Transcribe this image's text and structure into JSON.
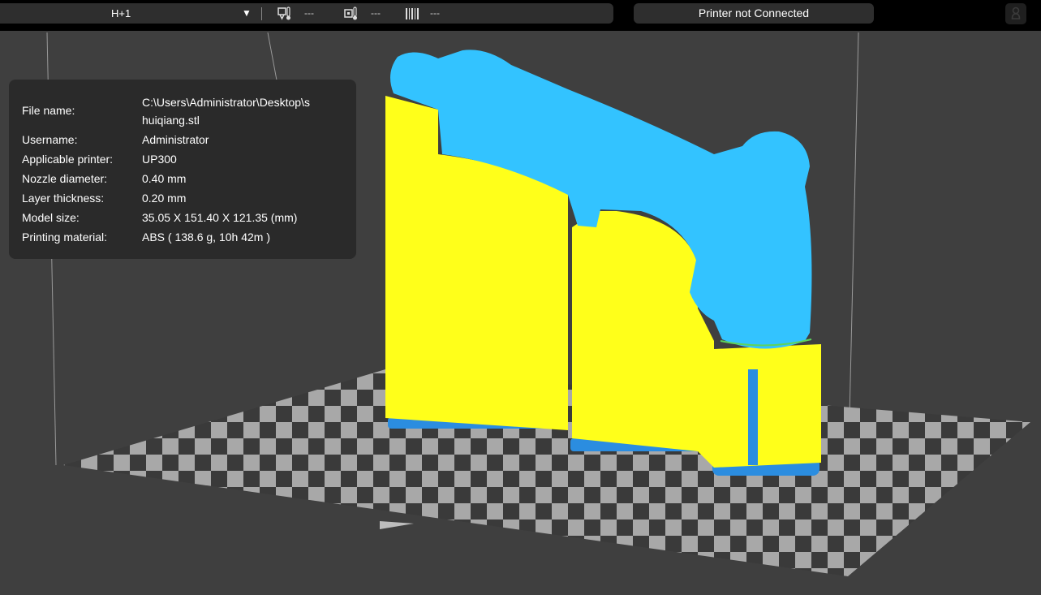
{
  "topbar": {
    "printer_name": "H+1",
    "dropdown_arrow": "▼",
    "nozzle_temp": "---",
    "bed_temp": "---",
    "progress": "---",
    "printer_status": "Printer not Connected"
  },
  "info": {
    "file_name_label": "File name:",
    "file_name_line1": "C:\\Users\\Administrator\\Desktop\\s",
    "file_name_line2": "huiqiang.stl",
    "username_label": "Username:",
    "username": "Administrator",
    "printer_label": "Applicable printer:",
    "printer": "UP300",
    "nozzle_label": "Nozzle diameter:",
    "nozzle": "0.40 mm",
    "layer_label": "Layer thickness:",
    "layer": "0.20 mm",
    "size_label": "Model size:",
    "size": "35.05 X 151.40 X 121.35 (mm)",
    "material_label": "Printing material:",
    "material": "ABS ( 138.6 g, 10h 42m )"
  },
  "colors": {
    "background": "#3f3f3f",
    "model": "#33c3ff",
    "support": "#ffff1a",
    "platform_light": "#a8a8a8",
    "platform_dark": "#3a3a3a"
  },
  "icons": {
    "nozzle": "nozzle-temperature-icon",
    "bed": "bed-temperature-icon",
    "progress": "progress-barcode-icon",
    "user": "user-icon"
  }
}
